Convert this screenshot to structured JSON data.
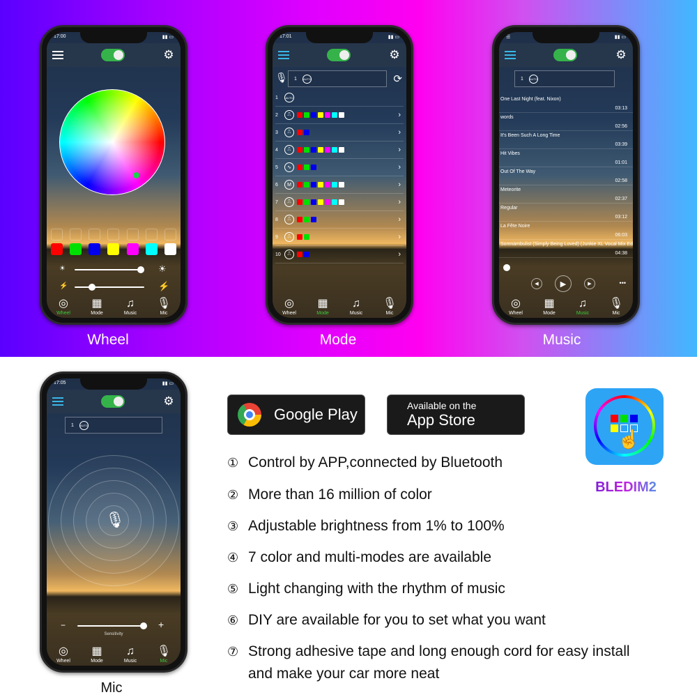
{
  "phones": {
    "wheel": {
      "time": "17:00",
      "caption": "Wheel",
      "swatch_colors": [
        "#ff0000",
        "#00e000",
        "#0000ee",
        "#ffff00",
        "#ff00ff",
        "#00ffff",
        "#ffffff"
      ],
      "brightness_pct": 95,
      "speed_pct": 25
    },
    "mode": {
      "time": "17:01",
      "caption": "Mode",
      "current_mode": "1",
      "auto_label": "AUTO",
      "rows": [
        {
          "num": "1",
          "icon": "AUTO",
          "colors": []
        },
        {
          "num": "2",
          "icon": "⎍",
          "colors": [
            "#ff0000",
            "#00e000",
            "#0000ee",
            "#ffff00",
            "#ff00ff",
            "#00ffff",
            "#ffffff"
          ]
        },
        {
          "num": "3",
          "icon": "⎍",
          "colors": [
            "#ff0000",
            "#0000ee"
          ]
        },
        {
          "num": "4",
          "icon": "⎍",
          "colors": [
            "#ff0000",
            "#00e000",
            "#0000ee",
            "#ffff00",
            "#ff00ff",
            "#00ffff",
            "#ffffff"
          ]
        },
        {
          "num": "5",
          "icon": "∿",
          "colors": [
            "#ff0000",
            "#00e000",
            "#0000ee"
          ]
        },
        {
          "num": "6",
          "icon": "M",
          "colors": [
            "#ff0000",
            "#00e000",
            "#0000ee",
            "#ffff00",
            "#ff00ff",
            "#00ffff",
            "#ffffff"
          ]
        },
        {
          "num": "7",
          "icon": "⎍",
          "colors": [
            "#ff0000",
            "#00e000",
            "#0000ee",
            "#ffff00",
            "#ff00ff",
            "#00ffff",
            "#ffffff"
          ]
        },
        {
          "num": "8",
          "icon": "⎍",
          "colors": [
            "#ff0000",
            "#00e000",
            "#0000ee"
          ]
        },
        {
          "num": "9",
          "icon": "⎍",
          "colors": [
            "#ff0000",
            "#00e000"
          ]
        },
        {
          "num": "10",
          "icon": "⎍",
          "colors": [
            "#ff0000",
            "#0000ee"
          ]
        }
      ]
    },
    "music": {
      "caption": "Music",
      "current_mode": "1",
      "auto_label": "AUTO",
      "songs": [
        {
          "title": "One Last Night (feat. Nixon)",
          "duration": "03:13"
        },
        {
          "title": "words",
          "duration": "02:56"
        },
        {
          "title": "It's Been Such A Long Time",
          "duration": "03:39"
        },
        {
          "title": "Hit Vibes",
          "duration": "01:01"
        },
        {
          "title": "Out Of The Way",
          "duration": "02:58"
        },
        {
          "title": "Meteorite",
          "duration": "02:37"
        },
        {
          "title": "Regular",
          "duration": "03:12"
        },
        {
          "title": "La Fête Noire",
          "duration": "06:03"
        },
        {
          "title": "Somnambulist (Simply Being Loved) (Junkie XL Vocal Mix Edit)",
          "duration": "04:38"
        }
      ],
      "more_label": "•••"
    },
    "mic": {
      "time": "17:05",
      "caption": "Mic",
      "current_mode": "1",
      "auto_label": "AUTO",
      "sensitivity_label": "Sensitivity",
      "sensitivity_pct": 95
    }
  },
  "nav": {
    "wheel": "Wheel",
    "mode": "Mode",
    "music": "Music",
    "mic": "Mic"
  },
  "badges": {
    "google_play": "Google Play",
    "app_store_top": "Available on the",
    "app_store_bottom": "App Store"
  },
  "features": [
    {
      "n": "①",
      "text": "Control by APP,connected by Bluetooth"
    },
    {
      "n": "②",
      "text": "More than 16 million of color"
    },
    {
      "n": "③",
      "text": "Adjustable brightness from 1% to 100%"
    },
    {
      "n": "④",
      "text": "7 color and multi-modes are available"
    },
    {
      "n": "⑤",
      "text": "Light changing with the rhythm of music"
    },
    {
      "n": "⑥",
      "text": "DIY are available for you to set what you want"
    },
    {
      "n": "⑦",
      "text": "Strong adhesive tape and long enough cord for easy install"
    },
    {
      "n": "",
      "text": "and make your car more neat"
    }
  ],
  "app": {
    "name": "BLEDIM2"
  }
}
